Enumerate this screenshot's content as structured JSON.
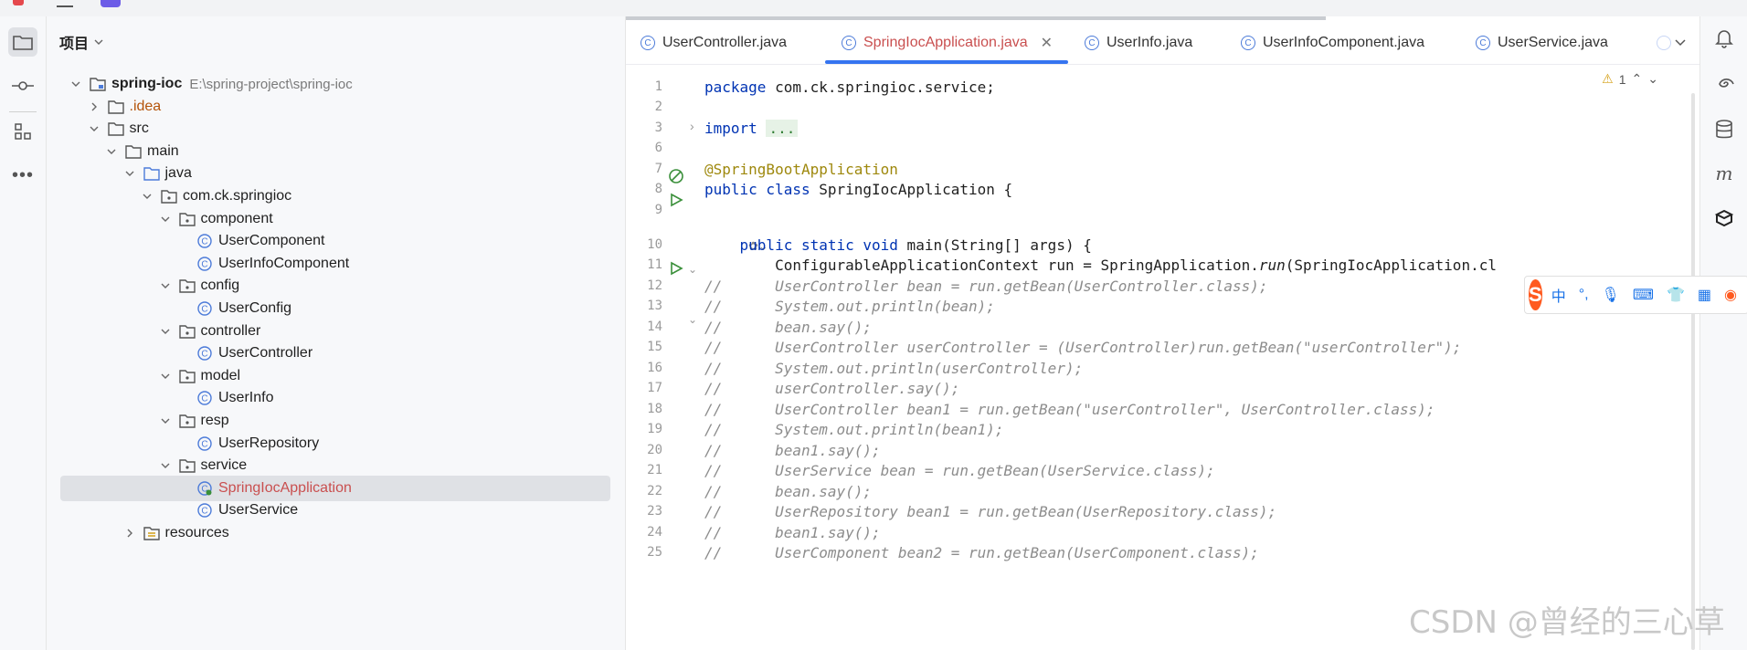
{
  "panel": {
    "title": "项目",
    "tree": [
      {
        "label": "spring-ioc",
        "path": "E:\\spring-project\\spring-ioc",
        "kind": "module",
        "depth": 0,
        "expanded": true
      },
      {
        "label": ".idea",
        "kind": "folder",
        "depth": 1,
        "expanded": false
      },
      {
        "label": "src",
        "kind": "folder",
        "depth": 1,
        "expanded": true
      },
      {
        "label": "main",
        "kind": "folder",
        "depth": 2,
        "expanded": true
      },
      {
        "label": "java",
        "kind": "source-folder",
        "depth": 3,
        "expanded": true
      },
      {
        "label": "com.ck.springioc",
        "kind": "package",
        "depth": 4,
        "expanded": true
      },
      {
        "label": "component",
        "kind": "package",
        "depth": 5,
        "expanded": true
      },
      {
        "label": "UserComponent",
        "kind": "class",
        "depth": 6
      },
      {
        "label": "UserInfoComponent",
        "kind": "class",
        "depth": 6
      },
      {
        "label": "config",
        "kind": "package",
        "depth": 5,
        "expanded": true
      },
      {
        "label": "UserConfig",
        "kind": "class",
        "depth": 6
      },
      {
        "label": "controller",
        "kind": "package",
        "depth": 5,
        "expanded": true
      },
      {
        "label": "UserController",
        "kind": "class",
        "depth": 6
      },
      {
        "label": "model",
        "kind": "package",
        "depth": 5,
        "expanded": true
      },
      {
        "label": "UserInfo",
        "kind": "class",
        "depth": 6
      },
      {
        "label": "resp",
        "kind": "package",
        "depth": 5,
        "expanded": true
      },
      {
        "label": "UserRepository",
        "kind": "class",
        "depth": 6
      },
      {
        "label": "service",
        "kind": "package",
        "depth": 5,
        "expanded": true
      },
      {
        "label": "SpringIocApplication",
        "kind": "spring-class",
        "depth": 6,
        "selected": true
      },
      {
        "label": "UserService",
        "kind": "class",
        "depth": 6
      },
      {
        "label": "resources",
        "kind": "resources-folder",
        "depth": 3,
        "expanded": false
      }
    ]
  },
  "editor": {
    "tabs": [
      {
        "label": "UserController.java",
        "active": false
      },
      {
        "label": "SpringIocApplication.java",
        "active": true
      },
      {
        "label": "UserInfo.java",
        "active": false
      },
      {
        "label": "UserInfoComponent.java",
        "active": false
      },
      {
        "label": "UserService.java",
        "active": false
      }
    ],
    "warning_count": "1",
    "lines": [
      {
        "n": "1",
        "parts": [
          {
            "t": "package",
            "c": "kw"
          },
          {
            "t": " com.ck.springioc.service;",
            "c": ""
          }
        ]
      },
      {
        "n": "2",
        "parts": []
      },
      {
        "n": "3",
        "parts": [
          {
            "t": "import",
            "c": "kw"
          },
          {
            "t": " ",
            "c": ""
          },
          {
            "t": "...",
            "c": "fold"
          }
        ]
      },
      {
        "n": "6",
        "parts": []
      },
      {
        "n": "7",
        "parts": [
          {
            "t": "@SpringBootApplication",
            "c": "ann"
          }
        ]
      },
      {
        "n": "8",
        "parts": [
          {
            "t": "public class",
            "c": "kw"
          },
          {
            "t": " SpringIocApplication {",
            "c": ""
          }
        ]
      },
      {
        "n": "9",
        "parts": []
      },
      {
        "n": "10",
        "parts": [
          {
            "t": "    public static void",
            "c": "kw"
          },
          {
            "t": " main(String[] args) {",
            "c": ""
          }
        ]
      },
      {
        "n": "11",
        "parts": [
          {
            "t": "        ConfigurableApplicationContext run = SpringApplication.",
            "c": ""
          },
          {
            "t": "run",
            "c": "it"
          },
          {
            "t": "(SpringIocApplication.cl",
            "c": ""
          }
        ]
      },
      {
        "n": "12",
        "parts": [
          {
            "t": "//      UserController bean = run.getBean(UserController.class);",
            "c": "cm"
          }
        ]
      },
      {
        "n": "13",
        "parts": [
          {
            "t": "//      System.out.println(bean);",
            "c": "cm"
          }
        ]
      },
      {
        "n": "14",
        "parts": [
          {
            "t": "//      bean.say();",
            "c": "cm"
          }
        ]
      },
      {
        "n": "15",
        "parts": [
          {
            "t": "//      UserController userController = (UserController)run.getBean(\"userController\");",
            "c": "cm"
          }
        ]
      },
      {
        "n": "16",
        "parts": [
          {
            "t": "//      System.out.println(userController);",
            "c": "cm"
          }
        ]
      },
      {
        "n": "17",
        "parts": [
          {
            "t": "//      userController.say();",
            "c": "cm"
          }
        ]
      },
      {
        "n": "18",
        "parts": [
          {
            "t": "//      UserController bean1 = run.getBean(\"userController\", UserController.class);",
            "c": "cm"
          }
        ]
      },
      {
        "n": "19",
        "parts": [
          {
            "t": "//      System.out.println(bean1);",
            "c": "cm"
          }
        ]
      },
      {
        "n": "20",
        "parts": [
          {
            "t": "//      bean1.say();",
            "c": "cm"
          }
        ]
      },
      {
        "n": "21",
        "parts": [
          {
            "t": "//      UserService bean = run.getBean(UserService.class);",
            "c": "cm"
          }
        ]
      },
      {
        "n": "22",
        "parts": [
          {
            "t": "//      bean.say();",
            "c": "cm"
          }
        ]
      },
      {
        "n": "23",
        "parts": [
          {
            "t": "//      UserRepository bean1 = run.getBean(UserRepository.class);",
            "c": "cm"
          }
        ]
      },
      {
        "n": "24",
        "parts": [
          {
            "t": "//      bean1.say();",
            "c": "cm"
          }
        ]
      },
      {
        "n": "25",
        "parts": [
          {
            "t": "//      UserComponent bean2 = run.getBean(UserComponent.class);",
            "c": "cm"
          }
        ]
      }
    ]
  },
  "ime": {
    "logo": "S",
    "lang": "中",
    "punct": "°,"
  },
  "watermark": "CSDN @曾经的三心草",
  "colors": {
    "accent": "#3574f0",
    "selected_file": "#c94f4f",
    "keyword": "#0033b3",
    "annotation": "#9e880d",
    "comment": "#8c8c8c"
  }
}
